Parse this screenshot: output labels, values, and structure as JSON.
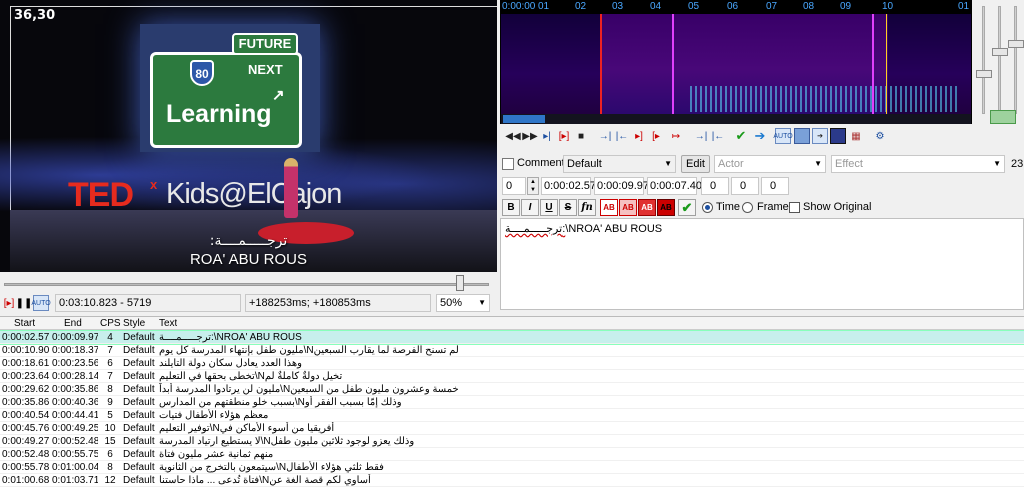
{
  "video": {
    "frame_number": "36,30",
    "scene_future": "FUTURE",
    "scene_next": "NEXT",
    "scene_route": "80",
    "scene_learning": "Learning",
    "scene_tedx": "TED",
    "scene_tedx_x": "x",
    "scene_event": "Kids@ElCajon",
    "subtitle_line1": "ترجـــــمــــة:",
    "subtitle_line2": "ROA' ABU ROUS"
  },
  "player": {
    "position": "0:03:10.823 - 5719",
    "offset": "+188253ms; +180853ms",
    "zoom": "50%",
    "seek_fraction": 0.94
  },
  "waveform": {
    "ruler_ticks": [
      "0:00:00",
      "01",
      "02",
      "03",
      "04",
      "05",
      "06",
      "07",
      "08",
      "09",
      "10",
      "01"
    ]
  },
  "edit": {
    "comment_label": "Comment",
    "style_value": "Default",
    "edit_button": "Edit",
    "actor_placeholder": "Actor",
    "effect_placeholder": "Effect",
    "effect_number": "23",
    "layer": "0",
    "start_time": "0:00:02.57",
    "end_time": "0:00:09.97",
    "duration": "0:00:07.40",
    "margin_l": "0",
    "margin_r": "0",
    "margin_v": "0",
    "bold": "B",
    "italic": "I",
    "underline": "U",
    "strike": "S",
    "fn": "fn",
    "ab1": "AB",
    "ab2": "AB",
    "ab3": "AB",
    "ab4": "AB",
    "time_label": "Time",
    "frame_label": "Frame",
    "show_original_label": "Show Original",
    "text_prefix": "ترجـــــمــــة:",
    "text_rest": "\\NROA' ABU ROUS"
  },
  "grid": {
    "headers": {
      "start": "Start",
      "end": "End",
      "cps": "CPS",
      "style": "Style",
      "text": "Text"
    },
    "rows": [
      {
        "start": "0:00:02.57",
        "end": "0:00:09.97",
        "cps": "4",
        "style": "Default",
        "text": "ترجـــــمــــة:\\NROA' ABU ROUS"
      },
      {
        "start": "0:00:10.90",
        "end": "0:00:18.37",
        "cps": "7",
        "style": "Default",
        "text": "مليون طفل بإنتهاء المدرسة كل يوم\\Nلم تسنح الفرصة لما يقارب السبعين"
      },
      {
        "start": "0:00:18.61",
        "end": "0:00:23.56",
        "cps": "6",
        "style": "Default",
        "text": "وهذا العدد يعادل سكان دولة التايلند"
      },
      {
        "start": "0:00:23.64",
        "end": "0:00:28.14",
        "cps": "7",
        "style": "Default",
        "text": "تخطى بحقها في التعليم\\Nتخيل دولةٌ كاملةٌ لم"
      },
      {
        "start": "0:00:29.62",
        "end": "0:00:35.86",
        "cps": "8",
        "style": "Default",
        "text": "مليون لن يرتادوا المدرسة أبداً\\Nخمسة وعشرون مليون طفل من السبعين"
      },
      {
        "start": "0:00:35.86",
        "end": "0:00:40.36",
        "cps": "9",
        "style": "Default",
        "text": "بسبب خلو منطقتهم من المدارس\\Nوذلك إمّا بسبب الفقر أو"
      },
      {
        "start": "0:00:40.54",
        "end": "0:00:44.41",
        "cps": "5",
        "style": "Default",
        "text": "معظم هؤلاء الأطفال فتيات"
      },
      {
        "start": "0:00:45.76",
        "end": "0:00:49.25",
        "cps": "10",
        "style": "Default",
        "text": "توفير التعليم\\Nأفريقيا من أسوء الأماكن في"
      },
      {
        "start": "0:00:49.27",
        "end": "0:00:52.48",
        "cps": "15",
        "style": "Default",
        "text": "لا يستطيع ارتياد المدرسة\\Nوذلك يعزو لوجود ثلاثين مليون طفل"
      },
      {
        "start": "0:00:52.48",
        "end": "0:00:55.75",
        "cps": "6",
        "style": "Default",
        "text": "منهم ثمانية عشر مليون فتاة"
      },
      {
        "start": "0:00:55.78",
        "end": "0:01:00.04",
        "cps": "8",
        "style": "Default",
        "text": "سيتمعون بالتخرج من الثانوية\\Nفقط ثلثي هؤلاء الأطفال"
      },
      {
        "start": "0:01:00.68",
        "end": "0:01:03.71",
        "cps": "12",
        "style": "Default",
        "text": "فتاة تُدعى ... ماذا حاستنا\\Nأساوي لكم قصة الغة عن"
      }
    ]
  },
  "colors": {
    "selected_row": "#c7efec",
    "waveform_selection": "#4a087a",
    "start_marker": "#e22222",
    "keyframe_marker": "#e040fb",
    "ruler_text": "#4aa8ff"
  },
  "icons": [
    "play-icon",
    "pause-icon",
    "auto-scroll-icon",
    "check-icon",
    "arrow-right-icon",
    "commit-icon",
    "time-radio-icon"
  ]
}
